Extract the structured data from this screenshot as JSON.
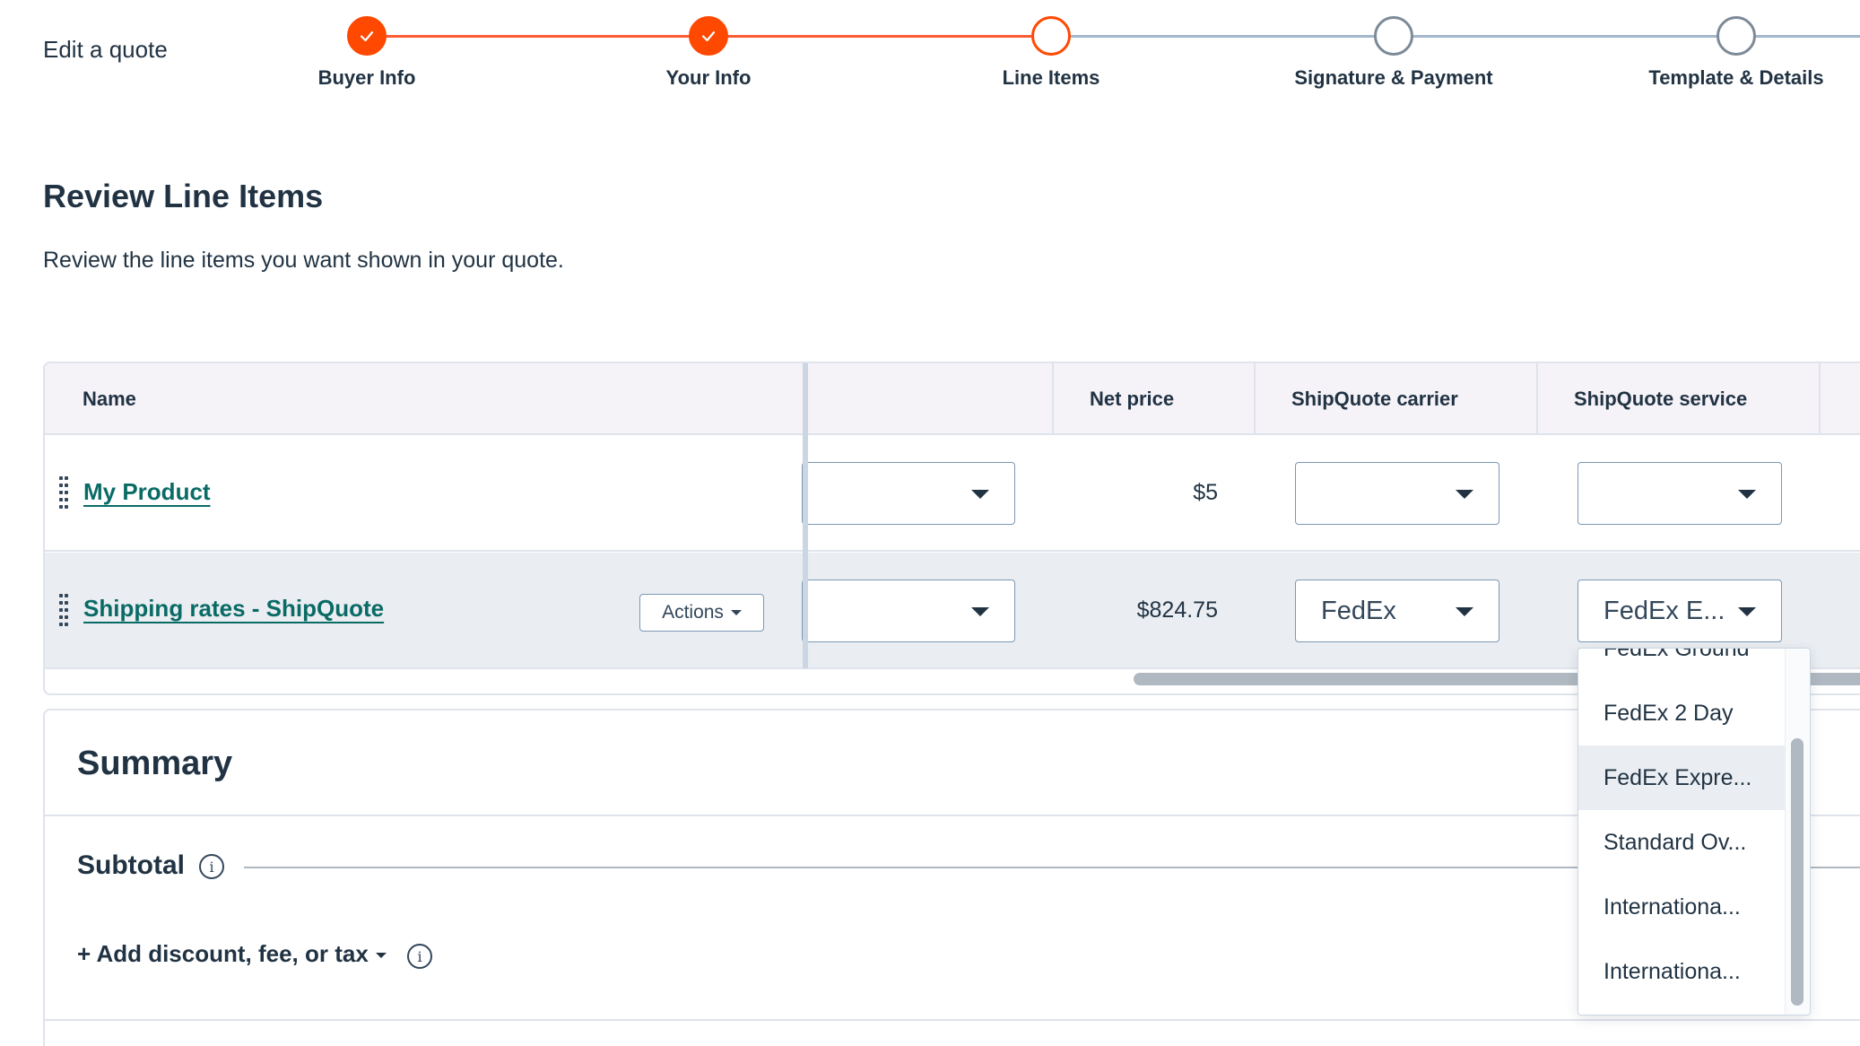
{
  "header": {
    "page_label": "Edit a quote",
    "steps": [
      {
        "label": "Buyer Info",
        "status": "done"
      },
      {
        "label": "Your Info",
        "status": "done"
      },
      {
        "label": "Line Items",
        "status": "current"
      },
      {
        "label": "Signature & Payment",
        "status": "todo"
      },
      {
        "label": "Template & Details",
        "status": "todo"
      }
    ]
  },
  "section": {
    "title": "Review Line Items",
    "description": "Review the line items you want shown in your quote."
  },
  "table": {
    "headers": {
      "name": "Name",
      "net_price": "Net price",
      "carrier": "ShipQuote carrier",
      "service": "ShipQuote service"
    },
    "rows": [
      {
        "name": "My Product",
        "net_price": "$5",
        "carrier": "",
        "service": "",
        "first_select": ""
      },
      {
        "name": "Shipping rates - ShipQuote",
        "actions_label": "Actions",
        "net_price": "$824.75",
        "carrier": "FedEx",
        "service": "FedEx E...",
        "first_select": ""
      }
    ]
  },
  "summary": {
    "title": "Summary",
    "subtotal_label": "Subtotal",
    "add_label": "+ Add discount, fee, or tax"
  },
  "service_dropdown": {
    "options": [
      "FedEx Ground",
      "FedEx 2 Day",
      "FedEx Expre...",
      "Standard Ov...",
      "Internationa...",
      "Internationa..."
    ],
    "highlighted": "FedEx Expre..."
  },
  "colors": {
    "accent": "#ff4800",
    "link": "#0a6b66",
    "text": "#213343"
  }
}
